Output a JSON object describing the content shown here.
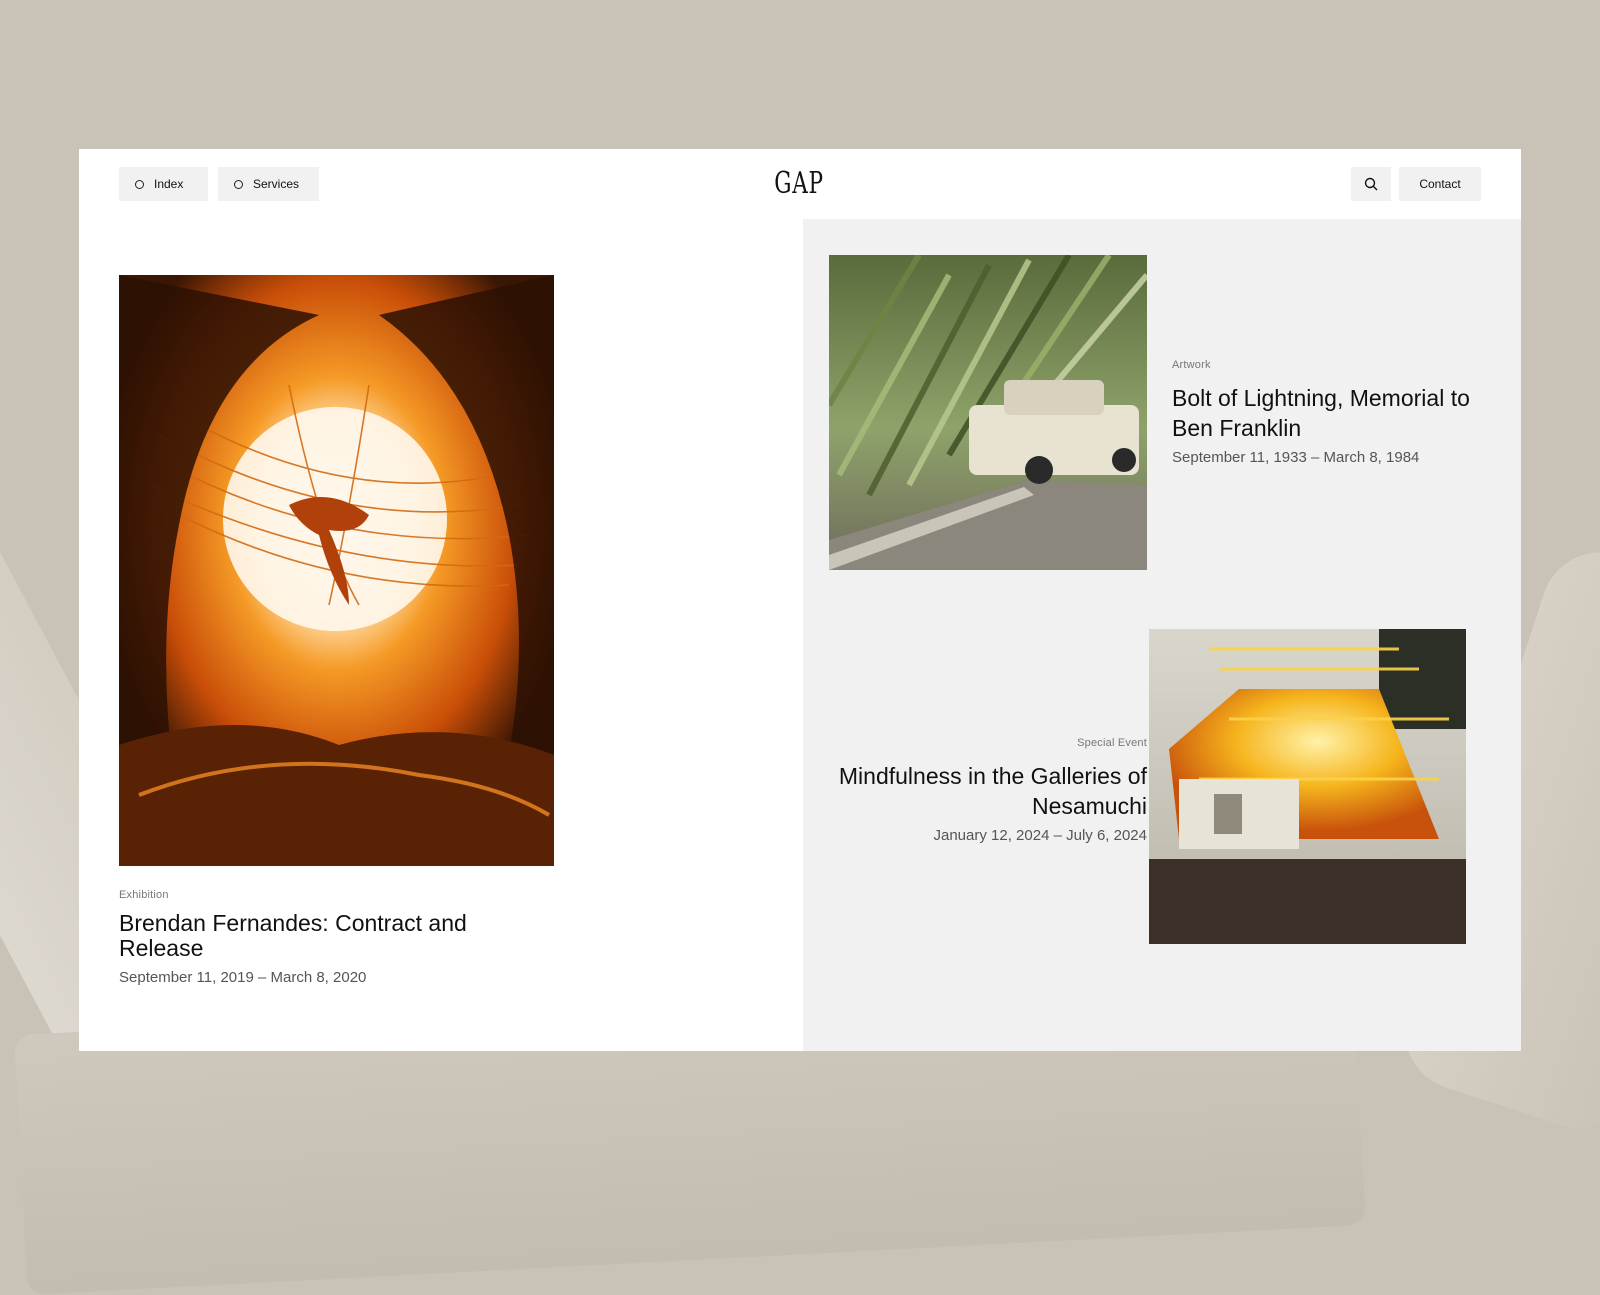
{
  "nav": {
    "index_label": "Index",
    "services_label": "Services",
    "logo_text": "GAP",
    "contact_label": "Contact",
    "search_icon": "search-icon"
  },
  "featured": {
    "category": "Exhibition",
    "title": "Brendan Fernandes: Contract and Release",
    "dates": "September 11, 2019 – March 8, 2020"
  },
  "cards": [
    {
      "category": "Artwork",
      "title": "Bolt of Lightning, Memorial to Ben Franklin",
      "dates": "September 11, 1933 – March 8, 1984"
    },
    {
      "category": "Special Event",
      "title": "Mindfulness in the Galleries of Nesamuchi",
      "dates": "January 12, 2024 – July 6, 2024"
    }
  ],
  "colors": {
    "backdrop": "#c9c2b6",
    "panel": "#f1f1f1",
    "frame": "#ffffff"
  }
}
